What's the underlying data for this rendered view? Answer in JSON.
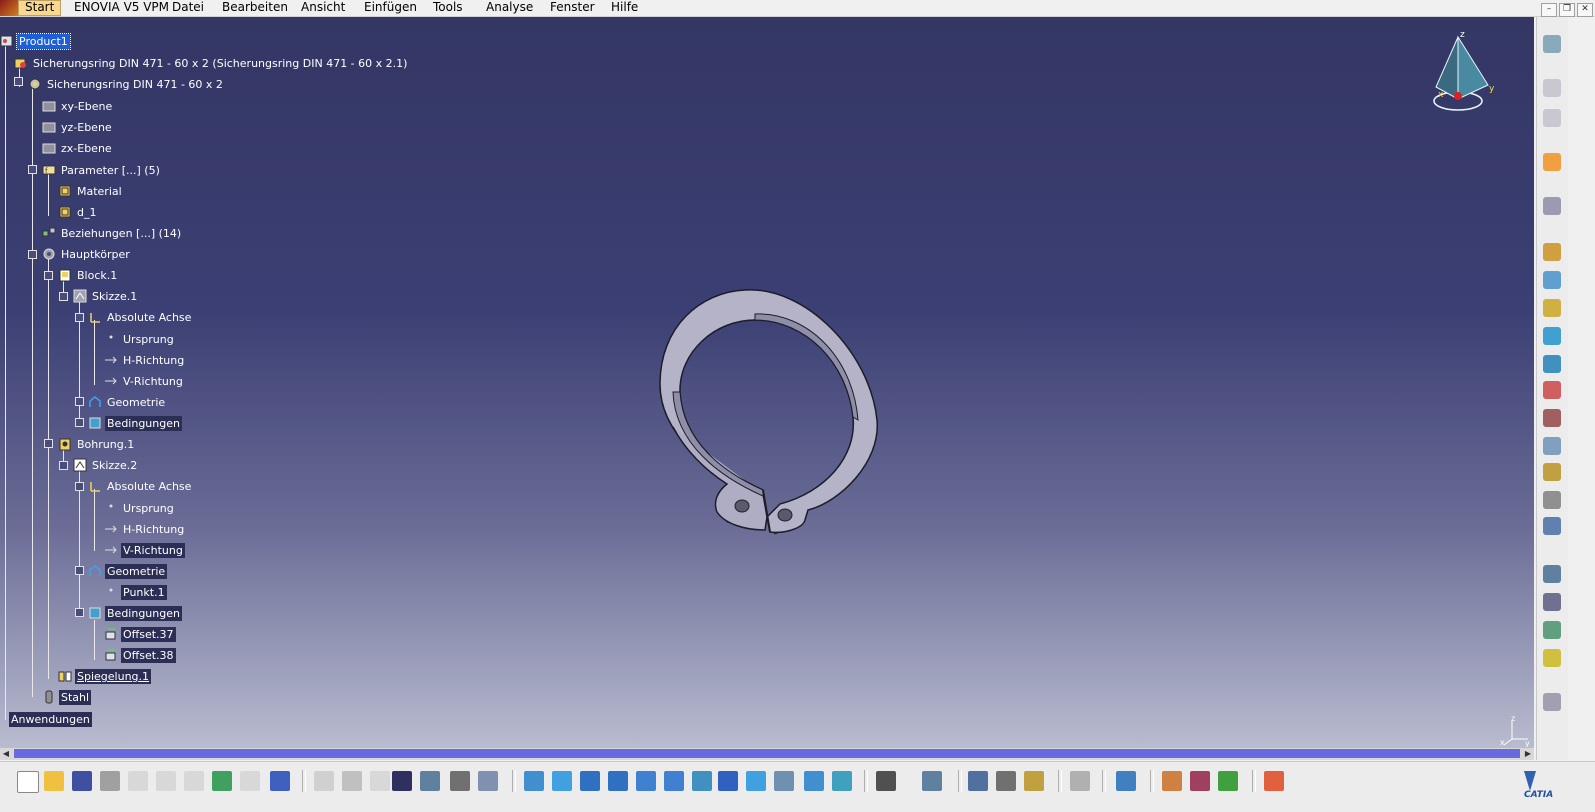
{
  "menubar": {
    "items": [
      "Start",
      "ENOVIA V5 VPM",
      "Datei",
      "Bearbeiten",
      "Ansicht",
      "Einfügen",
      "Tools",
      "Analyse",
      "Fenster",
      "Hilfe"
    ],
    "active": "Start"
  },
  "tree": {
    "root": "Product1",
    "part_instance": "Sicherungsring DIN 471 - 60 x 2 (Sicherungsring DIN 471 - 60 x 2.1)",
    "part": "Sicherungsring DIN 471 - 60 x 2",
    "planes": [
      "xy-Ebene",
      "yz-Ebene",
      "zx-Ebene"
    ],
    "parameters": "Parameter [...] (5)",
    "parameter_items": [
      "Material",
      "d_1"
    ],
    "relations": "Beziehungen [...] (14)",
    "body": "Hauptkörper",
    "block": "Block.1",
    "sketch1": "Skizze.1",
    "absolute_axis": "Absolute Achse",
    "origin": "Ursprung",
    "h_dir": "H-Richtung",
    "v_dir": "V-Richtung",
    "geometry": "Geometrie",
    "constraints": "Bedingungen",
    "hole": "Bohrung.1",
    "sketch2": "Skizze.2",
    "point": "Punkt.1",
    "offset37": "Offset.37",
    "offset38": "Offset.38",
    "mirror": "Spiegelung.1",
    "material": "Stahl",
    "applications": "Anwendungen"
  },
  "compass": {
    "x_label": "x",
    "y_label": "y",
    "z_label": "z"
  },
  "small_axis": {
    "x_label": "x",
    "y_label": "y",
    "z_label": "z"
  },
  "colors": {
    "accent": "#1d5fd6",
    "bg_top": "#343764",
    "bg_bottom": "#b9bccf",
    "ring": "#b4b3c8"
  },
  "right_toolbar_icons": [
    "compass-icon",
    "gear-icon",
    "tree-icon",
    "select-icon",
    "rotate-icon",
    "gear-icon",
    "gear-icon",
    "gear-icon",
    "export-icon",
    "edit-icon",
    "xfer-icon",
    "table-icon",
    "text-icon",
    "layers-icon",
    "tree-icon",
    "gear-icon",
    "layers-icon",
    "bike-icon",
    "expand-icon",
    "star-icon",
    "axis-icon"
  ],
  "bottom_toolbar_icons": [
    "new-icon",
    "open-icon",
    "save-icon",
    "print-icon",
    "cut-icon",
    "copy-icon",
    "paste-icon",
    "undo-icon",
    "redo-icon",
    "help-icon",
    "formula-icon",
    "comment-icon",
    "link-icon",
    "table-icon",
    "graph-icon",
    "lock-icon",
    "catalog-icon",
    "fly-icon",
    "fit-icon",
    "pan-icon",
    "rotate-icon",
    "zoom-in-icon",
    "zoom-out-icon",
    "normal-view-icon",
    "iso-view-icon",
    "cube-icon",
    "show-icon",
    "swap-icon",
    "capture-icon",
    "camera-icon",
    "select-icon",
    "measure-icon",
    "mass-icon",
    "bottle-icon",
    "refresh-icon",
    "plane-icon",
    "render-icon",
    "material-icon",
    "color-icon",
    "grid-icon"
  ]
}
